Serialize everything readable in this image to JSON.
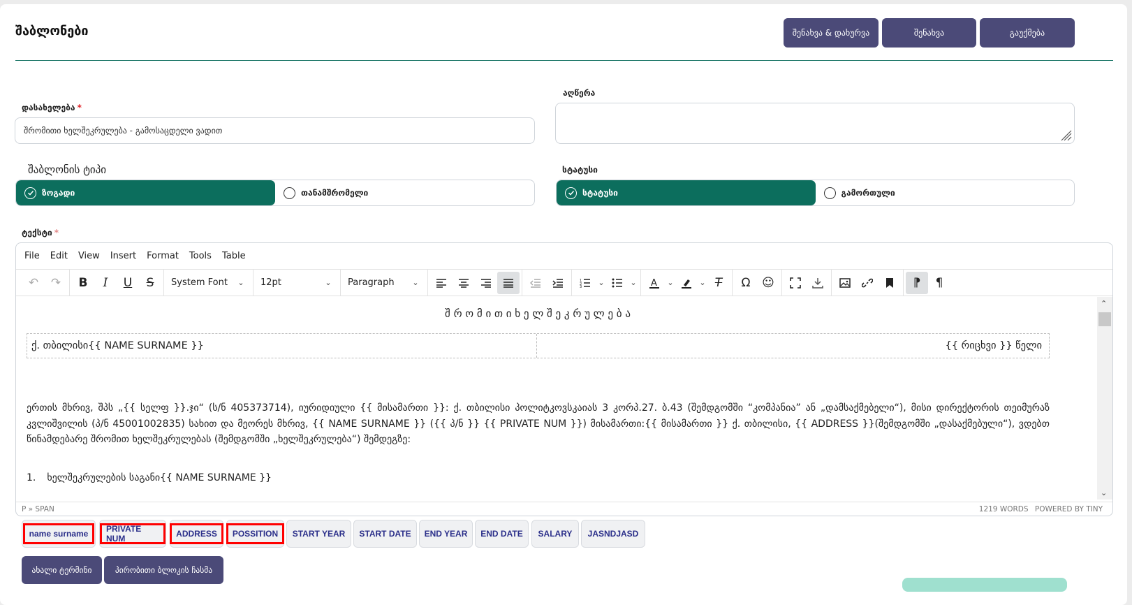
{
  "header": {
    "title": "შაბლონები",
    "buttons": [
      "შენახვა & დახურვა",
      "შენახვა",
      "გაუქმება"
    ]
  },
  "form": {
    "name_label": "დასახელება",
    "name_value": "შრომითი ხელშეკრულება - გამოსაცდელი ვადით",
    "description_label": "აღწერა",
    "template_type_label": "შაბლონის ტიპი",
    "template_type_options": [
      "ზოგადი",
      "თანამშრომელი"
    ],
    "status_label": "სტატუსი",
    "status_options": [
      "სტატუსი",
      "გამორთული"
    ],
    "text_label": "ტექსტი"
  },
  "editor": {
    "menu": [
      "File",
      "Edit",
      "View",
      "Insert",
      "Format",
      "Tools",
      "Table"
    ],
    "font_family": "System Font",
    "font_size": "12pt",
    "block_format": "Paragraph",
    "doc_title": "შ რ ო მ ი თ ი   ხ ე ლ შ ე კ რ უ ლ ე ბ ა",
    "place_left": "ქ. თბილისი{{ NAME SURNAME }}",
    "place_right": "{{ რიცხვი }} წელი",
    "paragraph": "ერთის მხრივ, შპს „{{ სელფ }}.ჯი“ (ს/ნ 405373714), იურიდიული {{ მისამართი }}: ქ. თბილისი პოლიტკოვსკაიას 3 კორპ.27. ბ.43 (შემდგომში “კომპანია” ან „დამსაქმებელი“), მისი დირექტორის თეიმურაზ კვლიშვილის (პ/ნ 45001002835) სახით და მეორეს მხრივ, {{ NAME SURNAME }} ({{ პ/ნ }} {{ PRIVATE NUM }}) მისამართი:{{ მისამართი }} ქ. თბილისი, {{ ADDRESS }}(შემდგომში „დასაქმებული“), ვდებთ წინამდებარე შრომით ხელშეკრულებას (შემდგომში „ხელშეკრულება“) შემდეგზე:",
    "list_number": "1.",
    "list_item": "ხელშეკრულების საგანი{{ NAME SURNAME }}",
    "path": "P » SPAN",
    "word_count": "1219 WORDS",
    "powered": "POWERED BY TINY"
  },
  "variables": [
    "name surname",
    "PRIVATE NUM",
    "ADDRESS",
    "POSSITION",
    "START YEAR",
    "START DATE",
    "END YEAR",
    "END DATE",
    "SALARY",
    "JASNDJASD"
  ],
  "bottom_buttons": [
    "ახალი ტერმინი",
    "პირობითი ბლოკის ჩასმა"
  ],
  "colors": {
    "primary": "#4b4a78",
    "teal": "#0c6e5d",
    "highlight": "#ff0000",
    "tag_text": "#2b2f8a"
  }
}
